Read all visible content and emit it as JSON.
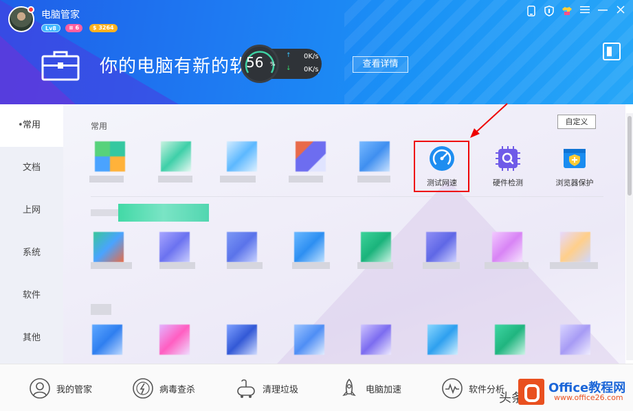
{
  "app": {
    "title": "电脑管家",
    "level": "Lv8",
    "badge_count": "6",
    "coins": "3264"
  },
  "header": {
    "headline": "你的电脑有新的软件可更新",
    "detail_button": "查看详情",
    "speed": {
      "percent": "56",
      "percent_sign": "%",
      "upload": "0K/s",
      "download": "0K/s"
    }
  },
  "sidebar": {
    "items": [
      "常用",
      "文档",
      "上网",
      "系统",
      "软件",
      "其他"
    ],
    "active": "常用"
  },
  "content": {
    "section_title": "常用",
    "custom_button": "自定义",
    "tools": [
      {
        "label": "测试网速",
        "icon": "speedometer-icon"
      },
      {
        "label": "硬件检测",
        "icon": "chip-icon"
      },
      {
        "label": "浏览器保护",
        "icon": "shield-icon"
      }
    ]
  },
  "bottom_nav": [
    {
      "label": "我的管家",
      "icon": "butler-icon"
    },
    {
      "label": "病毒查杀",
      "icon": "virus-scan-icon"
    },
    {
      "label": "清理垃圾",
      "icon": "cleanup-icon"
    },
    {
      "label": "电脑加速",
      "icon": "rocket-icon"
    },
    {
      "label": "软件分析",
      "icon": "analysis-icon"
    }
  ],
  "watermark": {
    "prefix": "头条",
    "title": "Office教程网",
    "url": "www.office26.com"
  },
  "colors": {
    "accent": "#1e7af2",
    "highlight": "#ee0000",
    "brand_orange": "#e9501f"
  }
}
